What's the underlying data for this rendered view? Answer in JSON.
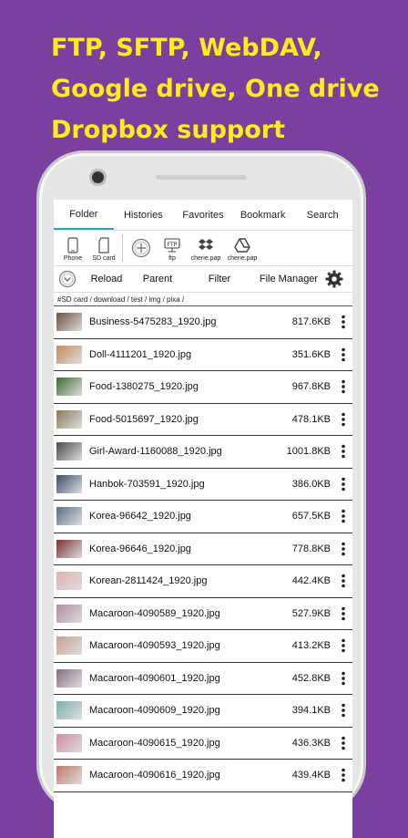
{
  "headline": [
    "FTP, SFTP, WebDAV,",
    "Google drive, One drive",
    "Dropbox support"
  ],
  "tabs": [
    "Folder",
    "Histories",
    "Favorites",
    "Bookmark",
    "Search"
  ],
  "storage": [
    {
      "label": "Phone",
      "icon": "phone-icon"
    },
    {
      "label": "SD card",
      "icon": "sd-card-icon"
    },
    {
      "label": "",
      "icon": "add-icon"
    },
    {
      "label": "ftp",
      "icon": "ftp-icon"
    },
    {
      "label": "cherie.pap",
      "icon": "dropbox-icon"
    },
    {
      "label": "cherie.pap",
      "icon": "google-drive-icon"
    }
  ],
  "actions": {
    "reload": "Reload",
    "parent": "Parent",
    "filter": "Filter",
    "file_manager": "File Manager"
  },
  "path": "#SD card / download / test / img / pixa /",
  "files": [
    {
      "name": "Business-5475283_1920.jpg",
      "size": "817.6KB",
      "thumb": "#6b5040"
    },
    {
      "name": "Doll-4111201_1920.jpg",
      "size": "351.6KB",
      "thumb": "#c98a5c"
    },
    {
      "name": "Food-1380275_1920.jpg",
      "size": "967.8KB",
      "thumb": "#3e6b2e"
    },
    {
      "name": "Food-5015697_1920.jpg",
      "size": "478.1KB",
      "thumb": "#8c7a5a"
    },
    {
      "name": "Girl-Award-1160088_1920.jpg",
      "size": "1001.8KB",
      "thumb": "#4a4a4a"
    },
    {
      "name": "Hanbok-703591_1920.jpg",
      "size": "386.0KB",
      "thumb": "#3a4a6e"
    },
    {
      "name": "Korea-96642_1920.jpg",
      "size": "657.5KB",
      "thumb": "#5a6e8a"
    },
    {
      "name": "Korea-96646_1920.jpg",
      "size": "778.8KB",
      "thumb": "#7a3030"
    },
    {
      "name": "Korean-2811424_1920.jpg",
      "size": "442.4KB",
      "thumb": "#e0b0b0"
    },
    {
      "name": "Macaroon-4090589_1920.jpg",
      "size": "527.9KB",
      "thumb": "#b08aa0"
    },
    {
      "name": "Macaroon-4090593_1920.jpg",
      "size": "413.2KB",
      "thumb": "#c7a090"
    },
    {
      "name": "Macaroon-4090601_1920.jpg",
      "size": "452.8KB",
      "thumb": "#8a6a80"
    },
    {
      "name": "Macaroon-4090609_1920.jpg",
      "size": "394.1KB",
      "thumb": "#7ab0b0"
    },
    {
      "name": "Macaroon-4090615_1920.jpg",
      "size": "436.3KB",
      "thumb": "#d08aa0"
    },
    {
      "name": "Macaroon-4090616_1920.jpg",
      "size": "439.4KB",
      "thumb": "#c07a6a"
    }
  ],
  "colors": {
    "background": "#7b3fa0",
    "headline": "#ffec1a",
    "tab_accent": "#2aa7b5"
  }
}
